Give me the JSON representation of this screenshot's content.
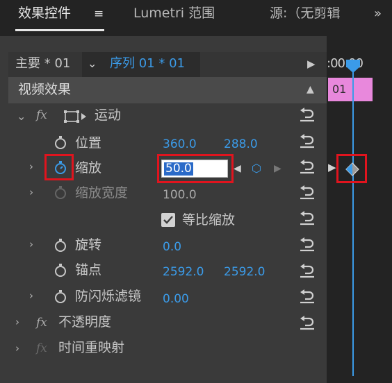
{
  "tabs": {
    "effect_controls": "效果控件",
    "menu_icon": "≡",
    "lumetri": "Lumetri 范围",
    "source": "源:（无剪辑",
    "overflow_icon": "»"
  },
  "master": {
    "label": "主要 * 01",
    "sequence": "序列 01 * 01"
  },
  "timeline": {
    "time": ":00:00",
    "clip": "01"
  },
  "video_effects": {
    "header": "视频效果"
  },
  "effects": {
    "motion": {
      "name": "运动",
      "fx": "fx",
      "properties": {
        "position": {
          "label": "位置",
          "x": "360.0",
          "y": "288.0"
        },
        "scale": {
          "label": "缩放",
          "value": "50.0"
        },
        "scale_width": {
          "label": "缩放宽度",
          "value": "100.0"
        },
        "uniform_scale": {
          "label": "等比缩放",
          "checked": true
        },
        "rotation": {
          "label": "旋转",
          "value": "0.0"
        },
        "anchor": {
          "label": "锚点",
          "x": "2592.0",
          "y": "2592.0"
        },
        "flicker": {
          "label": "防闪烁滤镜",
          "value": "0.00"
        }
      }
    },
    "opacity": {
      "name": "不透明度",
      "fx": "fx"
    },
    "time_remap": {
      "name": "时间重映射",
      "fx": "fx"
    }
  },
  "colors": {
    "accent_blue": "#3b9be8",
    "clip_pink": "#e888dc",
    "highlight_red": "#e0141e"
  },
  "icons": {
    "stopwatch": "stopwatch-icon",
    "reset": "reset-icon",
    "keyframe": "keyframe-diamond-icon",
    "transform": "transform-icon"
  }
}
